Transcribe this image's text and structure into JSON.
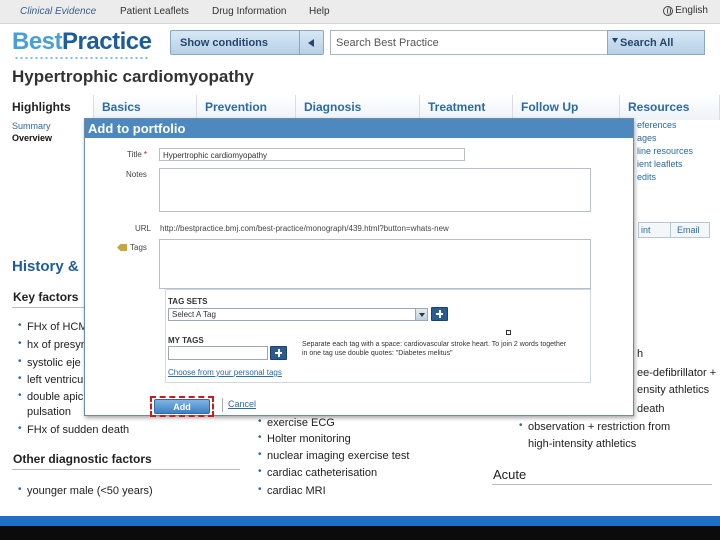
{
  "topbar": {
    "links": [
      "Clinical Evidence",
      "Patient Leaflets",
      "Drug Information",
      "Help"
    ],
    "language": "English"
  },
  "brand": {
    "part1": "Best",
    "part2": "Practice"
  },
  "header": {
    "show_conditions": "Show conditions",
    "search_placeholder": "Search Best Practice",
    "search_all": "Search All"
  },
  "page_title": "Hypertrophic cardiomyopathy",
  "tabs": [
    "Highlights",
    "Basics",
    "Prevention",
    "Diagnosis",
    "Treatment",
    "Follow Up",
    "Resources"
  ],
  "subnav": [
    "Summary",
    "Overview"
  ],
  "resources_links": [
    "eferences",
    "ages",
    "line resources",
    "ient leaflets",
    "edits"
  ],
  "actions": {
    "print": "int",
    "email": "Email"
  },
  "background": {
    "history_heading": "History &",
    "key_factors": "Key factors",
    "key_factor_items": [
      "FHx of HCM",
      "hx of presyn",
      "systolic eje",
      "left ventricu",
      "double apic",
      "pulsation",
      "FHx of sudden death"
    ],
    "other_factors": "Other diagnostic factors",
    "other_items": [
      "younger male (<50 years)"
    ],
    "tests": [
      "exercise ECG",
      "Holter monitoring",
      "nuclear imaging exercise test",
      "cardiac catheterisation",
      "cardiac MRI"
    ],
    "right_fragments": [
      "h",
      "ee-defibrillator +",
      "ensity athletics",
      "death"
    ],
    "right_items": [
      "observation + restriction from",
      "high-intensity athletics"
    ],
    "acute": "Acute"
  },
  "modal": {
    "title": "Add to portfolio",
    "title_label": "Title",
    "title_value": "Hypertrophic cardiomyopathy",
    "notes_label": "Notes",
    "url_label": "URL",
    "url_value": "http://bestpractice.bmj.com/best-practice/monograph/439.html?button=whats-new",
    "tags_label": "Tags",
    "tag_sets_label": "TAG SETS",
    "tag_sets_selected": "Select A Tag",
    "my_tags_label": "MY TAGS",
    "hint_text": "Separate each tag with a space: cardiovascular stroke heart. To join 2 words together in one tag use double quotes: \"Diabetes melitus\"",
    "choose_link": "Choose from your personal tags",
    "add_button": "Add",
    "cancel_link": "Cancel"
  }
}
